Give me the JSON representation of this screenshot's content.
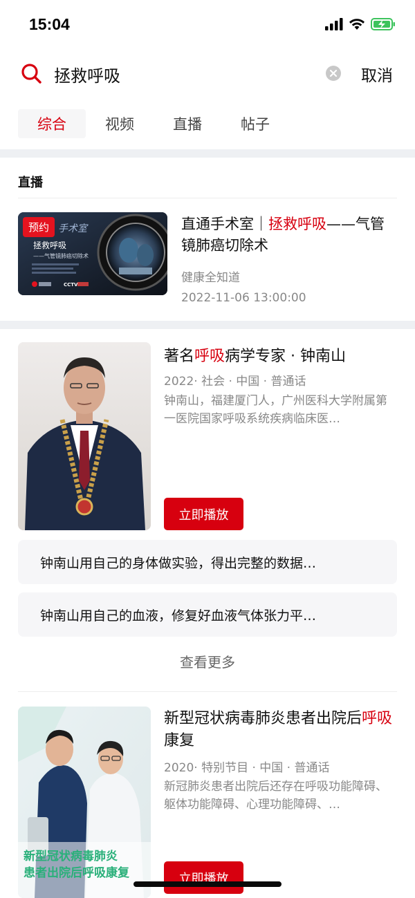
{
  "status": {
    "time": "15:04"
  },
  "search": {
    "query": "拯救呼吸",
    "cancel": "取消"
  },
  "tabs": [
    {
      "label": "综合",
      "active": true
    },
    {
      "label": "视频",
      "active": false
    },
    {
      "label": "直播",
      "active": false
    },
    {
      "label": "帖子",
      "active": false
    }
  ],
  "live_section": {
    "title": "直播",
    "card": {
      "badge": "预约",
      "title_pre": "直通手术室｜",
      "title_hl": "拯救呼吸",
      "title_post": "——气管镜肺癌切除术",
      "source": "健康全知道",
      "datetime": "2022-11-06 13:00:00",
      "thumb_text": {
        "logo": "手术室",
        "headline": "拯救呼吸",
        "subline": "——气管镜肺癌切除术",
        "cctv": "CCTV"
      }
    }
  },
  "person": {
    "title_pre": "著名",
    "title_hl": "呼吸",
    "title_post": "病学专家 · 钟南山",
    "meta": "2022· 社会 · 中国 · 普通话",
    "desc": "钟南山，福建厦门人，广州医科大学附属第一医院国家呼吸系统疾病临床医…",
    "play": "立即播放",
    "episodes": [
      "钟南山用自己的身体做实验，得出完整的数据…",
      "钟南山用自己的血液，修复好血液气体张力平…"
    ],
    "see_more": "查看更多"
  },
  "program": {
    "title_pre": "新型冠状病毒肺炎患者出院后",
    "title_hl": "呼吸",
    "title_post": "康复",
    "meta": "2020· 特别节目 · 中国 · 普通话",
    "desc": "新冠肺炎患者出院后还存在呼吸功能障碍、躯体功能障碍、心理功能障碍、…",
    "caption_line1": "新型冠状病毒肺炎",
    "caption_line2": "患者出院后呼吸康复",
    "play": "立即播放"
  },
  "colors": {
    "accent": "#d7000f",
    "muted": "#888888",
    "divider": "#eef0f3",
    "chip_bg": "#f6f6f8",
    "battery": "#3cc35c"
  },
  "icons": [
    "signal-icon",
    "wifi-icon",
    "battery-charging-icon",
    "search-icon",
    "clear-icon"
  ]
}
